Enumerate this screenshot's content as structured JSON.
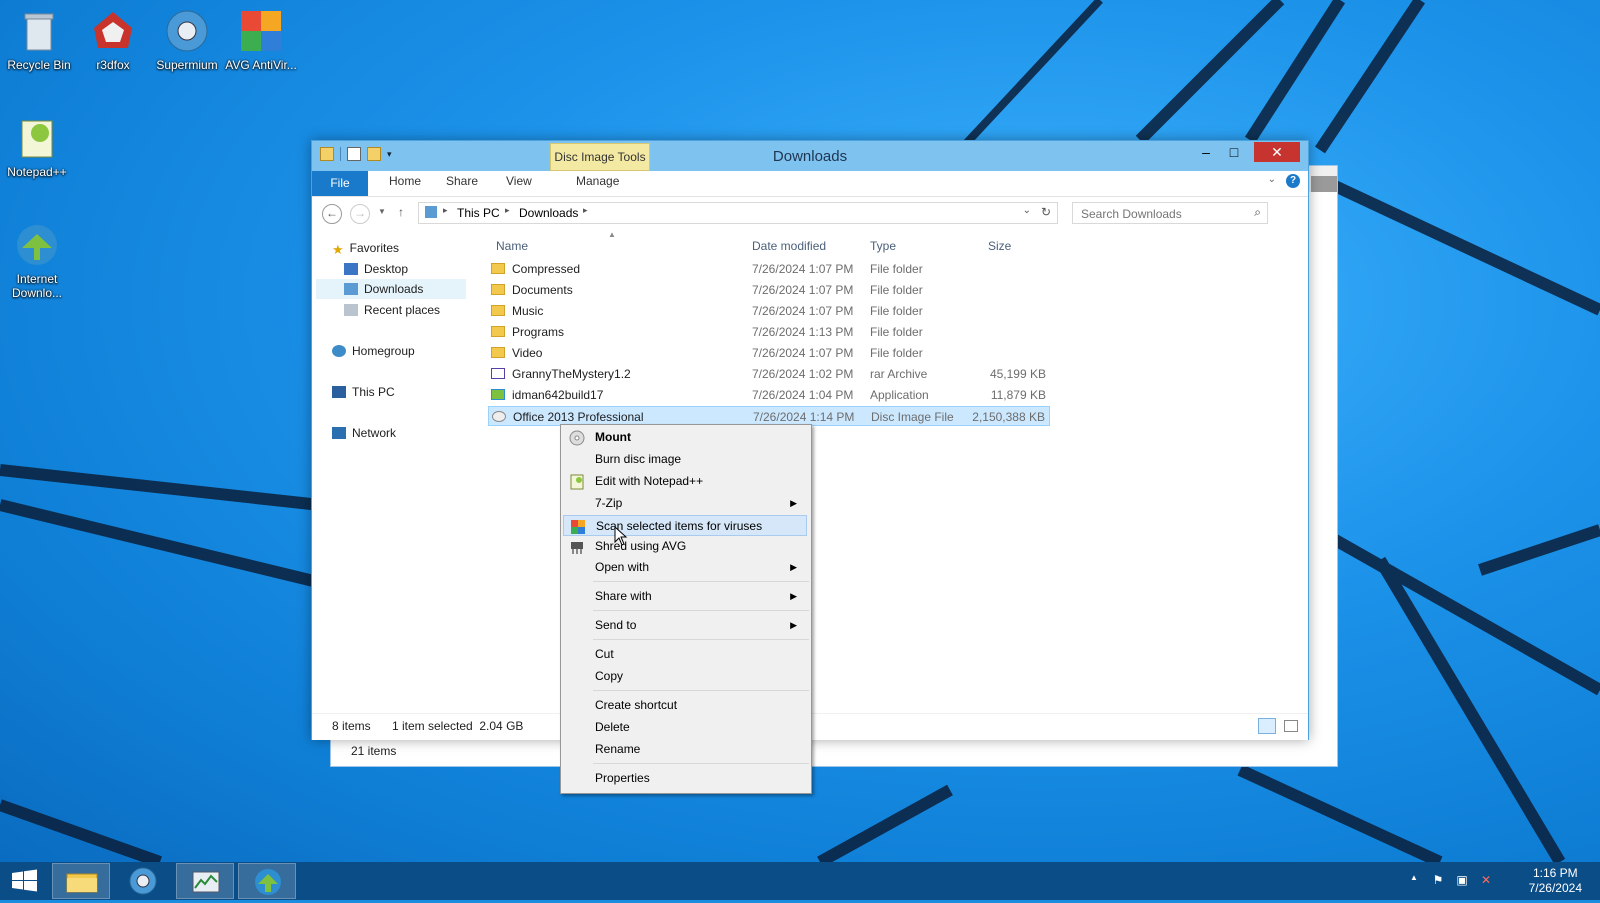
{
  "desktop": {
    "icons": [
      {
        "label": "Recycle Bin",
        "icon": "recycle-bin-icon"
      },
      {
        "label": "r3dfox",
        "icon": "r3dfox-icon"
      },
      {
        "label": "Supermium",
        "icon": "supermium-icon"
      },
      {
        "label": "AVG AntiVir...",
        "icon": "avg-icon"
      },
      {
        "label": "Notepad++",
        "icon": "notepad-plus-plus-icon"
      },
      {
        "label": "Internet Downlo...",
        "icon": "internet-download-manager-icon"
      }
    ]
  },
  "back_window": {
    "status": "21 items"
  },
  "explorer": {
    "title": "Downloads",
    "context_tab": "Disc Image Tools",
    "ribbon_tabs": [
      "File",
      "Home",
      "Share",
      "View",
      "Manage"
    ],
    "breadcrumb": [
      "This PC",
      "Downloads"
    ],
    "search_placeholder": "Search Downloads",
    "nav": {
      "favorites": "Favorites",
      "desktop": "Desktop",
      "downloads": "Downloads",
      "recent": "Recent places",
      "homegroup": "Homegroup",
      "this_pc": "This PC",
      "network": "Network"
    },
    "columns": {
      "name": "Name",
      "date": "Date modified",
      "type": "Type",
      "size": "Size"
    },
    "files": [
      {
        "name": "Compressed",
        "date": "7/26/2024 1:07 PM",
        "type": "File folder",
        "size": ""
      },
      {
        "name": "Documents",
        "date": "7/26/2024 1:07 PM",
        "type": "File folder",
        "size": ""
      },
      {
        "name": "Music",
        "date": "7/26/2024 1:07 PM",
        "type": "File folder",
        "size": ""
      },
      {
        "name": "Programs",
        "date": "7/26/2024 1:13 PM",
        "type": "File folder",
        "size": ""
      },
      {
        "name": "Video",
        "date": "7/26/2024 1:07 PM",
        "type": "File folder",
        "size": ""
      },
      {
        "name": "GrannyTheMystery1.2",
        "date": "7/26/2024 1:02 PM",
        "type": "rar Archive",
        "size": "45,199 KB"
      },
      {
        "name": "idman642build17",
        "date": "7/26/2024 1:04 PM",
        "type": "Application",
        "size": "11,879 KB"
      },
      {
        "name": "Office 2013 Professional",
        "date": "7/26/2024 1:14 PM",
        "type": "Disc Image File",
        "size": "2,150,388 KB"
      }
    ],
    "status": {
      "items": "8 items",
      "selected": "1 item selected  2.04 GB"
    }
  },
  "context_menu": {
    "items": [
      {
        "label": "Mount",
        "bold": true,
        "icon": "disc-icon"
      },
      {
        "label": "Burn disc image"
      },
      {
        "label": "Edit with Notepad++",
        "icon": "notepad-plus-plus-icon"
      },
      {
        "label": "7-Zip",
        "submenu": true
      },
      {
        "label": "Scan selected items for viruses",
        "icon": "avg-icon",
        "highlighted": true
      },
      {
        "label": "Shred using AVG",
        "icon": "shredder-icon"
      },
      {
        "label": "Open with",
        "submenu": true
      },
      {
        "label": "Share with",
        "submenu": true
      },
      {
        "label": "Send to",
        "submenu": true
      },
      {
        "label": "Cut"
      },
      {
        "label": "Copy"
      },
      {
        "label": "Create shortcut"
      },
      {
        "label": "Delete"
      },
      {
        "label": "Rename"
      },
      {
        "label": "Properties"
      }
    ]
  },
  "taskbar": {
    "time": "1:16 PM",
    "date": "7/26/2024",
    "pinned": [
      "start-icon",
      "file-explorer-icon",
      "supermium-icon",
      "task-manager-icon",
      "internet-download-manager-icon"
    ]
  },
  "colors": {
    "accent": "#1979ca",
    "selection": "#cce8ff",
    "context_tab": "#f3e9a3",
    "close": "#c7332f"
  }
}
